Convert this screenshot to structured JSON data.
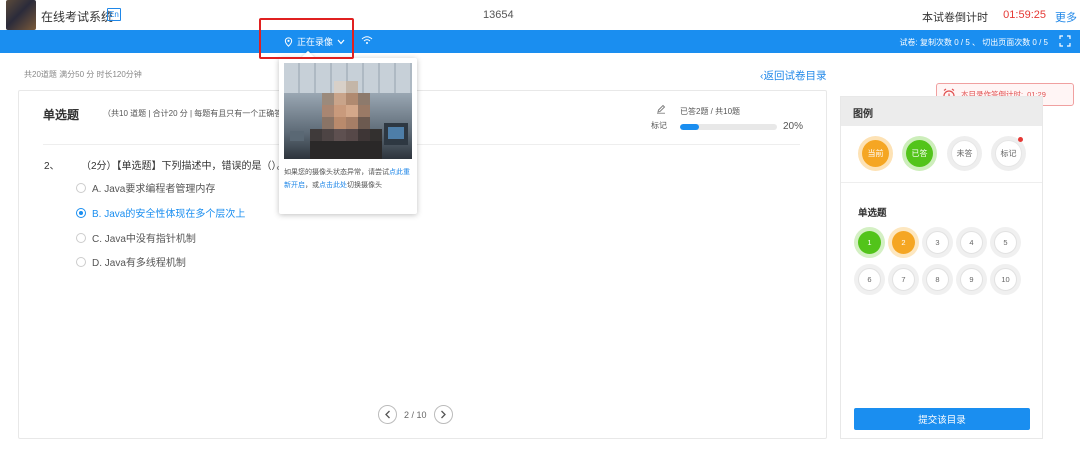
{
  "header": {
    "system_title": "在线考试系统",
    "lang_badge": "En",
    "exam_id": "13654",
    "countdown_label": "本试卷倒计时",
    "countdown_value": "01:59:25",
    "more": "更多"
  },
  "toolbar": {
    "recording_label": "正在录像",
    "stats": "试卷:  复制次数 0 / 5 、 切出页面次数 0 / 5"
  },
  "exam_meta": "共20道题    满分50 分    时长120分钟",
  "back_link": "返回试卷目录",
  "question_panel": {
    "section_title": "单选题",
    "section_desc": "（共10 道题 | 合计20 分 | 每题有且只有一个正确答案）",
    "mark_label": "标记",
    "progress_text": "已答2题  /  共10题",
    "progress_fraction": 0.2,
    "progress_pct": "20%",
    "question_number": "2、",
    "question_stem": "（2分）【单选题】下列描述中，错误的是（）。",
    "options": [
      {
        "label": "A. Java要求编程者管理内存",
        "selected": false
      },
      {
        "label": "B. Java的安全性体现在多个层次上",
        "selected": true
      },
      {
        "label": "C. Java中没有指针机制",
        "selected": false
      },
      {
        "label": "D. Java有多线程机制",
        "selected": false
      }
    ],
    "pager_text": "2 / 10"
  },
  "camera_popup": {
    "text_before": "如果您的摄像头状态异常，请尝试",
    "link1": "点此重新开启",
    "text_mid": "，或",
    "link2": "点击此处",
    "text_after": "切换摄像头"
  },
  "timer_toast": {
    "label": "本目录作答倒计时:",
    "value": "01:29"
  },
  "legend": {
    "title": "图例",
    "items": [
      {
        "label": "当前",
        "color": "#f5a623",
        "ring": "#fde2b5",
        "text": "#ffffff"
      },
      {
        "label": "已答",
        "color": "#52c41a",
        "ring": "#cdeebb",
        "text": "#ffffff"
      },
      {
        "label": "未答",
        "color": "#ffffff",
        "ring": "#eeeeee",
        "text": "#666666"
      },
      {
        "label": "标记",
        "color": "#ffffff",
        "ring": "#eeeeee",
        "text": "#666666",
        "dot": "#e53935"
      }
    ],
    "section_title": "单选题",
    "questions": [
      {
        "n": "1",
        "state": "answered"
      },
      {
        "n": "2",
        "state": "current"
      },
      {
        "n": "3",
        "state": "unanswered"
      },
      {
        "n": "4",
        "state": "unanswered"
      },
      {
        "n": "5",
        "state": "unanswered"
      },
      {
        "n": "6",
        "state": "unanswered"
      },
      {
        "n": "7",
        "state": "unanswered"
      },
      {
        "n": "8",
        "state": "unanswered"
      },
      {
        "n": "9",
        "state": "unanswered"
      },
      {
        "n": "10",
        "state": "unanswered"
      }
    ],
    "submit_label": "提交该目录"
  },
  "colors": {
    "primary": "#1a8ef0",
    "danger": "#e53935",
    "highlight_box": "#e02020"
  }
}
